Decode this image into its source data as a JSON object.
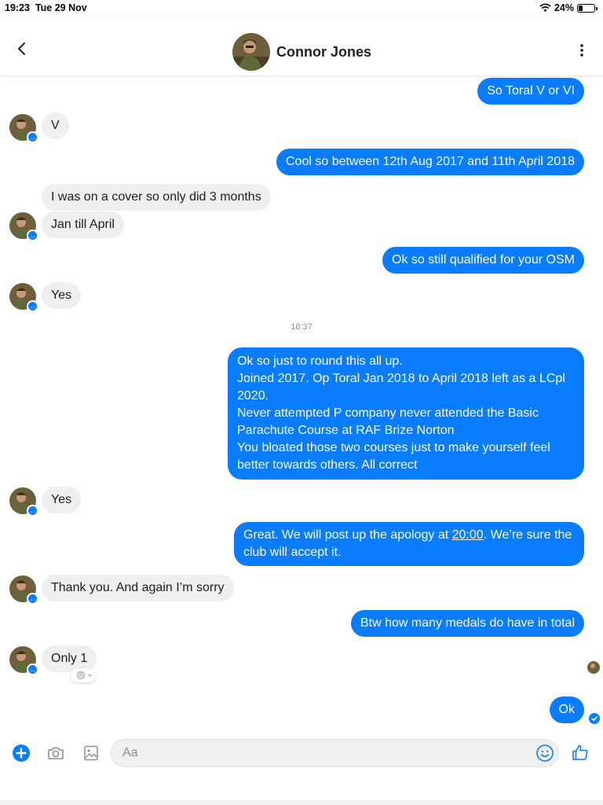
{
  "status_bar": {
    "time": "19:23",
    "date": "Tue 29 Nov",
    "battery": "24%",
    "battery_level": 0.24
  },
  "header": {
    "contact_name": "Connor Jones"
  },
  "messages": [
    {
      "side": "out",
      "text": "So Toral V or VI"
    },
    {
      "side": "in",
      "text": "V"
    },
    {
      "side": "out",
      "text": "Cool so between 12th Aug 2017 and 11th April 2018"
    },
    {
      "side": "in",
      "text": "I was on a cover so only did 3 months"
    },
    {
      "side": "in",
      "text": "Jan till April"
    },
    {
      "side": "out",
      "text": "Ok so still qualified for your OSM"
    },
    {
      "side": "in",
      "text": "Yes"
    },
    {
      "side": "out",
      "lines": [
        "Ok so just to round this all up.",
        "Joined 2017. Op Toral Jan 2018 to April 2018 left as a LCpl 2020.",
        "Never attempted P company never attended the Basic Parachute Course at RAF Brize Norton",
        "You bloated those two courses just to make yourself feel better towards others. All correct"
      ]
    },
    {
      "side": "in",
      "text": "Yes"
    },
    {
      "side": "out",
      "text_before": "Great. We will post up the apology at ",
      "link": "20:00",
      "text_after": ". We’re sure the club will accept it."
    },
    {
      "side": "in",
      "text": "Thank you. And again I’m sorry"
    },
    {
      "side": "out",
      "text": "Btw how many medals do have in total"
    },
    {
      "side": "in",
      "text": "Only 1"
    },
    {
      "side": "out",
      "text": "Ok"
    }
  ],
  "timestamp": "18:37",
  "composer": {
    "placeholder": "Aa"
  },
  "colors": {
    "accent": "#0a7cff",
    "incoming_bubble": "#efefef",
    "outgoing_text": "#ffffff"
  },
  "icons": [
    "back-chevron-icon",
    "more-vertical-icon",
    "plus-icon",
    "camera-icon",
    "photo-icon",
    "emoji-icon",
    "thumbs-up-icon",
    "messenger-badge-icon",
    "add-reaction-icon",
    "delivered-check-icon"
  ]
}
